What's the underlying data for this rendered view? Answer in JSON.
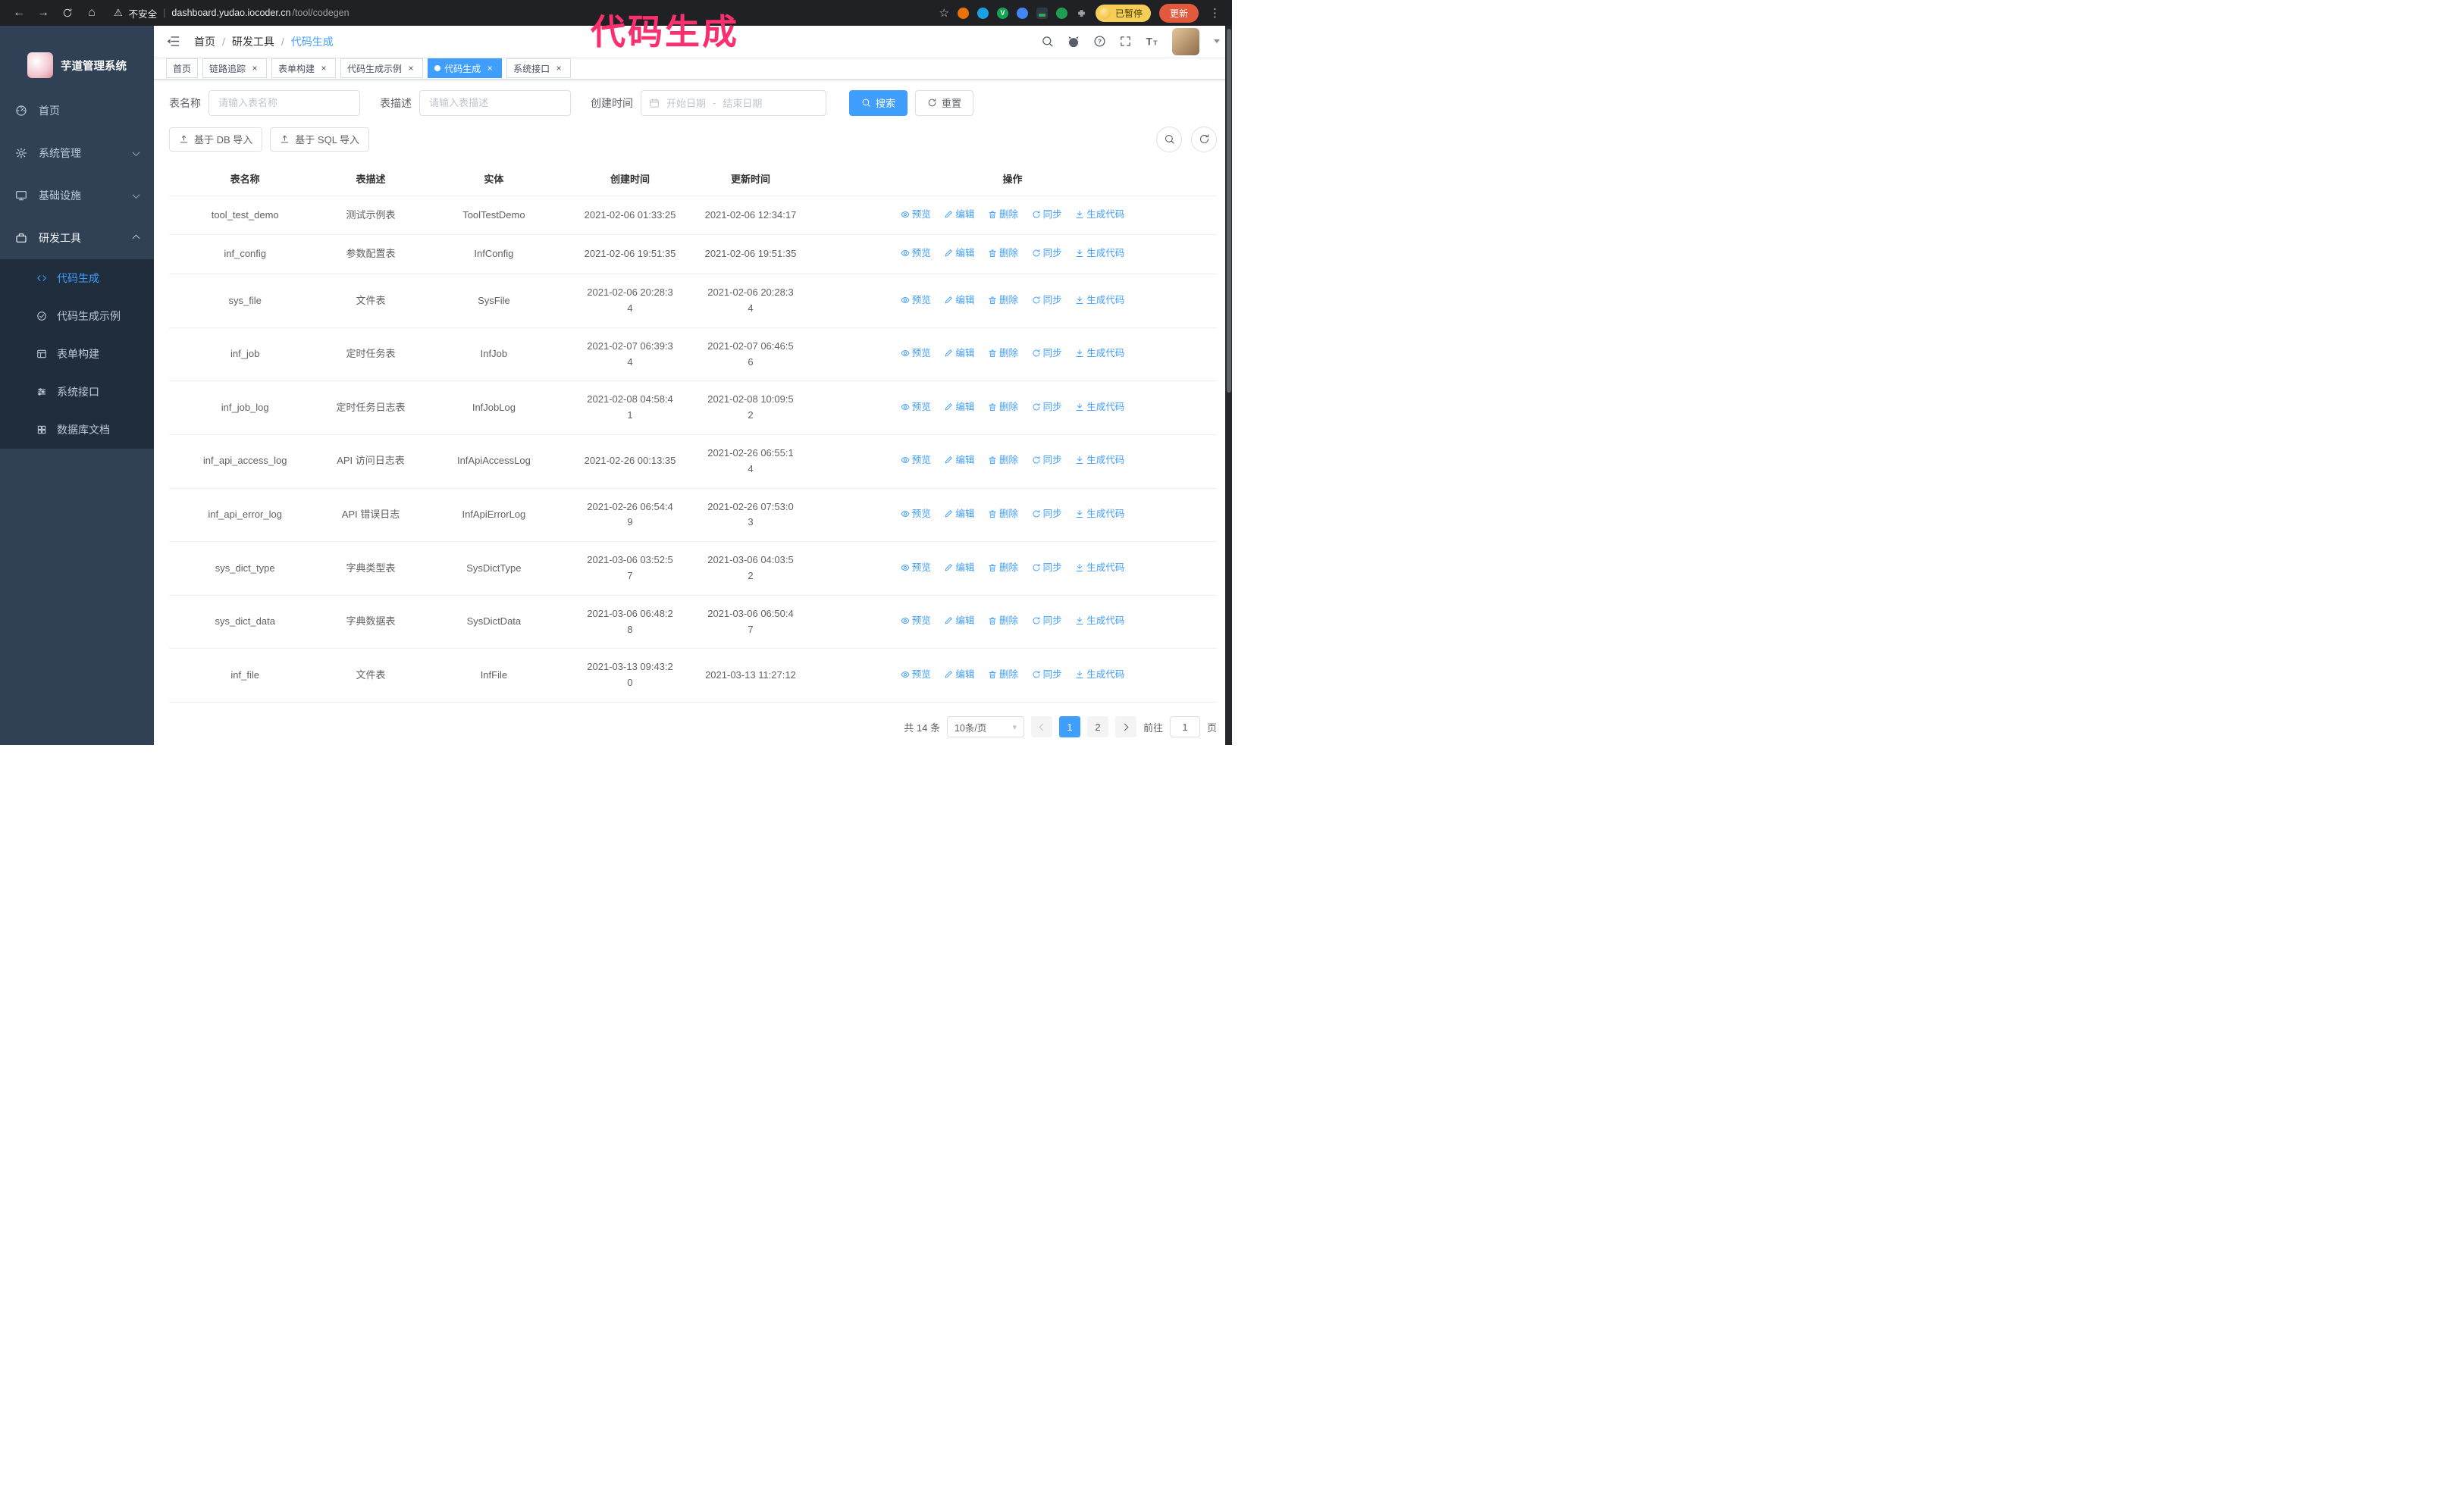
{
  "annotation": {
    "text": "代码生成"
  },
  "colors": {
    "accent": "#409EFF",
    "annotation": "#fa2f6e",
    "sidebar_bg": "#304156",
    "submenu_bg": "#1f2d3d",
    "active_tab_bg": "#409EFF",
    "update_button_bg": "#e2593c",
    "paused_badge_bg": "#f4ce56"
  },
  "browser": {
    "security_warning": "不安全",
    "url_host": "dashboard.yudao.iocoder.cn",
    "url_path": "/tool/codegen",
    "paused_badge": "已暂停",
    "update_button": "更新"
  },
  "sidebar": {
    "app_title": "芋道管理系统",
    "items": [
      {
        "label": "首页"
      },
      {
        "label": "系统管理"
      },
      {
        "label": "基础设施"
      },
      {
        "label": "研发工具"
      }
    ],
    "sub_items": [
      {
        "label": "代码生成"
      },
      {
        "label": "代码生成示例"
      },
      {
        "label": "表单构建"
      },
      {
        "label": "系统接口"
      },
      {
        "label": "数据库文档"
      }
    ]
  },
  "header": {
    "breadcrumb": [
      "首页",
      "研发工具",
      "代码生成"
    ],
    "breadcrumb_separator": "/"
  },
  "tabs": [
    {
      "label": "首页"
    },
    {
      "label": "链路追踪"
    },
    {
      "label": "表单构建"
    },
    {
      "label": "代码生成示例"
    },
    {
      "label": "代码生成"
    },
    {
      "label": "系统接口"
    }
  ],
  "filters": {
    "table_name_label": "表名称",
    "table_name_placeholder": "请输入表名称",
    "table_desc_label": "表描述",
    "table_desc_placeholder": "请输入表描述",
    "create_time_label": "创建时间",
    "date_start_placeholder": "开始日期",
    "date_separator": "-",
    "date_end_placeholder": "结束日期",
    "search_button": "搜索",
    "reset_button": "重置"
  },
  "toolbar": {
    "import_db": "基于 DB 导入",
    "import_sql": "基于 SQL 导入"
  },
  "table": {
    "columns": [
      "表名称",
      "表描述",
      "实体",
      "创建时间",
      "更新时间",
      "操作"
    ],
    "op_labels": [
      "预览",
      "编辑",
      "删除",
      "同步",
      "生成代码"
    ],
    "rows": [
      {
        "name": "tool_test_demo",
        "desc": "测试示例表",
        "entity": "ToolTestDemo",
        "created": "2021-02-06 01:33:25",
        "updated": "2021-02-06 12:34:17"
      },
      {
        "name": "inf_config",
        "desc": "参数配置表",
        "entity": "InfConfig",
        "created": "2021-02-06 19:51:35",
        "updated": "2021-02-06 19:51:35"
      },
      {
        "name": "sys_file",
        "desc": "文件表",
        "entity": "SysFile",
        "created": "2021-02-06 20:28:3\n4",
        "updated": "2021-02-06 20:28:3\n4"
      },
      {
        "name": "inf_job",
        "desc": "定时任务表",
        "entity": "InfJob",
        "created": "2021-02-07 06:39:3\n4",
        "updated": "2021-02-07 06:46:5\n6"
      },
      {
        "name": "inf_job_log",
        "desc": "定时任务日志表",
        "entity": "InfJobLog",
        "created": "2021-02-08 04:58:4\n1",
        "updated": "2021-02-08 10:09:5\n2"
      },
      {
        "name": "inf_api_access_log",
        "desc": "API 访问日志表",
        "entity": "InfApiAccessLog",
        "created": "2021-02-26 00:13:35",
        "updated": "2021-02-26 06:55:1\n4"
      },
      {
        "name": "inf_api_error_log",
        "desc": "API 错误日志",
        "entity": "InfApiErrorLog",
        "created": "2021-02-26 06:54:4\n9",
        "updated": "2021-02-26 07:53:0\n3"
      },
      {
        "name": "sys_dict_type",
        "desc": "字典类型表",
        "entity": "SysDictType",
        "created": "2021-03-06 03:52:5\n7",
        "updated": "2021-03-06 04:03:5\n2"
      },
      {
        "name": "sys_dict_data",
        "desc": "字典数据表",
        "entity": "SysDictData",
        "created": "2021-03-06 06:48:2\n8",
        "updated": "2021-03-06 06:50:4\n7"
      },
      {
        "name": "inf_file",
        "desc": "文件表",
        "entity": "InfFile",
        "created": "2021-03-13 09:43:2\n0",
        "updated": "2021-03-13 11:27:12"
      }
    ]
  },
  "pagination": {
    "total": "共 14 条",
    "page_size": "10条/页",
    "pages": [
      "1",
      "2"
    ],
    "active_page": "1",
    "goto_label": "前往",
    "goto_value": "1",
    "goto_unit": "页"
  }
}
